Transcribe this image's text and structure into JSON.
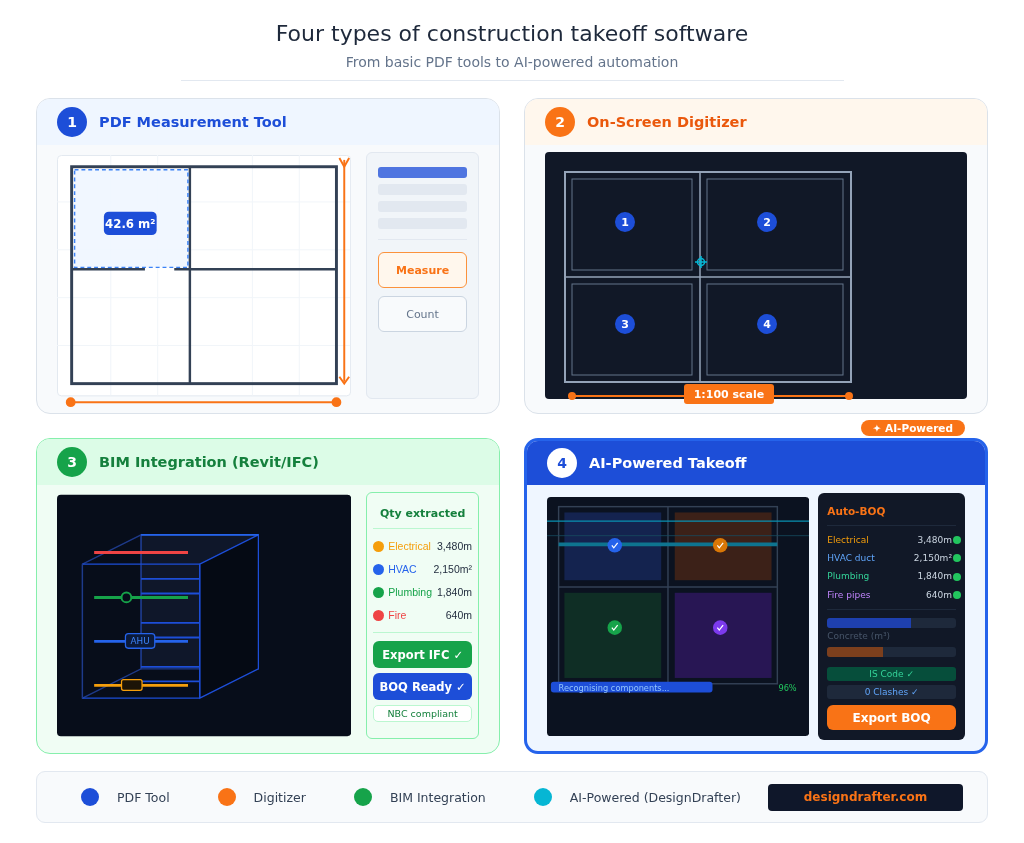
{
  "title": "Four types of construction takeoff software",
  "subtitle": "From basic PDF tools to AI-powered automation",
  "cards": [
    {
      "kind": "pdf",
      "number": "1",
      "title": "PDF Measurement Tool",
      "area_label": "42.6 m²",
      "tools": [
        {
          "label": "Measure",
          "selected": true
        },
        {
          "label": "Count",
          "selected": false
        }
      ]
    },
    {
      "kind": "digitizer",
      "number": "2",
      "title": "On-Screen Digitizer",
      "rooms": [
        "1",
        "2",
        "3",
        "4"
      ],
      "scale": "1:100 scale"
    },
    {
      "kind": "bim",
      "number": "3",
      "title": "BIM Integration (Revit/IFC)",
      "equipment_tag": "AHU",
      "panel_title": "Qty extracted",
      "quantities": [
        {
          "label": "Electrical",
          "value": "3,480m",
          "color": "#f59e0b"
        },
        {
          "label": "HVAC",
          "value": "2,150m²",
          "color": "#2563eb"
        },
        {
          "label": "Plumbing",
          "value": "1,840m",
          "color": "#16a34a"
        },
        {
          "label": "Fire",
          "value": "640m",
          "color": "#ef4444"
        }
      ],
      "actions": [
        {
          "label": "Export IFC ✓",
          "kind": "export"
        },
        {
          "label": "BOQ Ready ✓",
          "kind": "ready"
        }
      ],
      "compliance": "NBC compliant"
    },
    {
      "kind": "ai",
      "number": "4",
      "title": "AI-Powered Takeoff",
      "progress_label": "Recognising components...",
      "progress_reading": "96%",
      "panel_title": "Auto-BOQ",
      "quantities": [
        {
          "label": "Electrical",
          "value": "3,480m",
          "kind": "electrical"
        },
        {
          "label": "HVAC duct",
          "value": "2,150m²",
          "kind": "hvac"
        },
        {
          "label": "Plumbing",
          "value": "1,840m",
          "kind": "plumbing"
        },
        {
          "label": "Fire pipes",
          "value": "640m",
          "kind": "fire"
        }
      ],
      "bars": [
        {
          "level": 0.65,
          "color": "#1e40af"
        },
        {
          "level": 0.43,
          "color": "#7c3f1d"
        }
      ],
      "bar_label": "Concrete (m³)",
      "checks": [
        {
          "label": "IS Code ✓",
          "kind": "code"
        },
        {
          "label": "0 Clashes ✓",
          "kind": "clash"
        }
      ],
      "button": "Export BOQ"
    }
  ],
  "ai_badge": "✦ AI-Powered",
  "legend": [
    {
      "label": "PDF Tool",
      "color": "#1d4ed8"
    },
    {
      "label": "Digitizer",
      "color": "#f97316"
    },
    {
      "label": "BIM Integration",
      "color": "#16a34a"
    },
    {
      "label": "AI-Powered (DesignDrafter)",
      "color": "#06b6d4"
    }
  ],
  "site": "designdrafter.com"
}
